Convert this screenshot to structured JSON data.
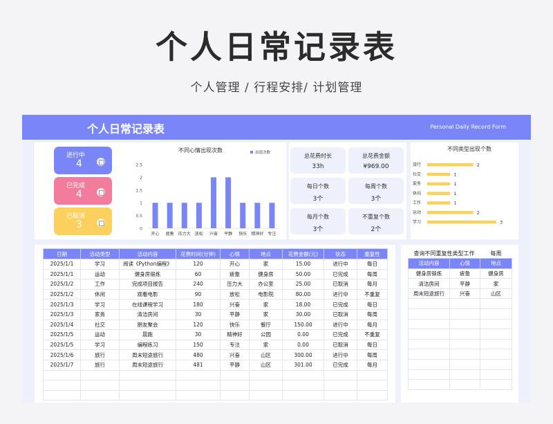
{
  "page": {
    "title": "个人日常记录表",
    "subtitle": "个人管理 / 行程安排/ 计划管理"
  },
  "banner": {
    "title": "个人日常记录表",
    "subtitle_en": "Personal Daily Record Form"
  },
  "colors": {
    "accent": "#7a86f7",
    "in_progress": "#7a86f7",
    "done": "#f27c9b",
    "cancelled": "#fcd05c",
    "bar_mood": "#7a86f7",
    "bar_type": "#fcd05c"
  },
  "status_cards": [
    {
      "label": "进行中",
      "value": "4",
      "icon": "calendar-icon"
    },
    {
      "label": "已完成",
      "value": "4",
      "icon": "calendar-icon"
    },
    {
      "label": "已取消",
      "value": "3",
      "icon": "calendar-icon"
    }
  ],
  "metrics": [
    {
      "label": "总花费时长",
      "value": "33h"
    },
    {
      "label": "总花费金额",
      "value": "¥969.00"
    },
    {
      "label": "每日个数",
      "value": "3个"
    },
    {
      "label": "每周个数",
      "value": "3个"
    },
    {
      "label": "每月个数",
      "value": "3个"
    },
    {
      "label": "不重复个数",
      "value": "2个"
    }
  ],
  "chart_data": [
    {
      "type": "bar",
      "title": "不同心情出现次数",
      "legend": "出现次数",
      "categories": [
        "开心",
        "疲惫",
        "压力大",
        "放松",
        "兴奋",
        "平静",
        "快乐",
        "精神好",
        "专注"
      ],
      "values": [
        1,
        1,
        1,
        1,
        2,
        2,
        1,
        1,
        1
      ],
      "yticks": [
        "0",
        "0.5",
        "1",
        "1.5",
        "2",
        "2.5"
      ],
      "ylim": [
        0,
        2.5
      ]
    },
    {
      "type": "bar",
      "orientation": "horizontal",
      "title": "不同类型出现个数",
      "categories": [
        "旅行",
        "社交",
        "家务",
        "休闲",
        "工作",
        "运动",
        "学习"
      ],
      "values": [
        2,
        1,
        1,
        1,
        1,
        2,
        3
      ],
      "xlim": [
        0,
        3
      ]
    }
  ],
  "table": {
    "headers": [
      "日期",
      "活动类型",
      "活动内容",
      "花费时间(分钟)",
      "心情",
      "地点",
      "花费金额(元)",
      "状态",
      "重复性"
    ],
    "rows": [
      [
        "2025/1/1",
        "学习",
        "阅读《Python编程》",
        "120",
        "开心",
        "家",
        "15.00",
        "进行中",
        "每日"
      ],
      [
        "2025/1/1",
        "运动",
        "健身房锻炼",
        "60",
        "疲惫",
        "健身房",
        "50.00",
        "已完成",
        "每周"
      ],
      [
        "2025/1/2",
        "工作",
        "完成项目报告",
        "240",
        "压力大",
        "办公室",
        "25.00",
        "已取消",
        "每月"
      ],
      [
        "2025/1/2",
        "休闲",
        "观看电影",
        "90",
        "放松",
        "电影院",
        "80.00",
        "进行中",
        "不重复"
      ],
      [
        "2025/1/3",
        "学习",
        "在线课程学习",
        "180",
        "兴奋",
        "家",
        "18.00",
        "已完成",
        "每日"
      ],
      [
        "2025/1/3",
        "家务",
        "清洁房间",
        "30",
        "平静",
        "家",
        "30.00",
        "已取消",
        "每周"
      ],
      [
        "2025/1/4",
        "社交",
        "朋友聚会",
        "120",
        "快乐",
        "餐厅",
        "150.00",
        "进行中",
        "每月"
      ],
      [
        "2025/1/5",
        "运动",
        "晨跑",
        "30",
        "精神好",
        "公园",
        "0.00",
        "已完成",
        "不重复"
      ],
      [
        "2025/1/5",
        "学习",
        "编程练习",
        "150",
        "专注",
        "家",
        "0.00",
        "已取消",
        "每日"
      ],
      [
        "2025/1/6",
        "旅行",
        "周末短途旅行",
        "480",
        "兴奋",
        "山区",
        "300.00",
        "进行中",
        "每周"
      ],
      [
        "2025/1/7",
        "旅行",
        "周末短途旅行",
        "481",
        "平静",
        "山区",
        "301.00",
        "已完成",
        "每月"
      ]
    ]
  },
  "query": {
    "label": "查询不同重复性类型工作",
    "value": "每周",
    "headers": [
      "活动内容",
      "心情",
      "地点"
    ],
    "rows": [
      [
        "健身房锻炼",
        "疲惫",
        "健身房"
      ],
      [
        "清洁房间",
        "平静",
        "家"
      ],
      [
        "周末短途旅行",
        "兴奋",
        "山区"
      ]
    ]
  }
}
